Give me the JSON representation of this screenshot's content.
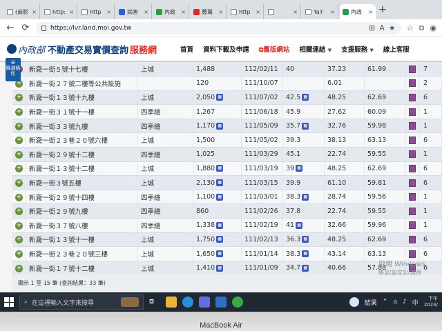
{
  "browser": {
    "tabs": [
      {
        "label": "(商影",
        "icon": "doc"
      },
      {
        "label": "http:",
        "icon": "doc"
      },
      {
        "label": "http",
        "icon": "doc"
      },
      {
        "label": "病害",
        "icon": "blue"
      },
      {
        "label": "內政",
        "icon": "green"
      },
      {
        "label": "豐萬",
        "icon": "red"
      },
      {
        "label": "http",
        "icon": "doc"
      },
      {
        "label": "",
        "icon": "doc"
      },
      {
        "label": "YaY",
        "icon": "doc"
      },
      {
        "label": "內政",
        "icon": "green"
      }
    ],
    "url": "https://lvr.land.moi.gov.tw"
  },
  "site": {
    "ministry": "內政部",
    "title": "不動產交易實價查詢",
    "title_suffix": "服務網",
    "nav": {
      "home": "首頁",
      "download": "資料下載及申請",
      "old_site": "舊版網站",
      "links": "相關連結",
      "support": "支援服務",
      "online": "線上客服"
    },
    "float_button": "篩選條件"
  },
  "table": {
    "rows": [
      {
        "address": "新瀧一街５號十七樓",
        "community": "上城",
        "price": "1,488",
        "pin_price": false,
        "date": "112/02/11",
        "area": "40",
        "pin_area": false,
        "price_a": "37.23",
        "price_b": "61.99",
        "floor": "7"
      },
      {
        "address": "新瀧一街２７號二樓等公共設施",
        "community": "",
        "price": "120",
        "pin_price": false,
        "date": "111/10/07",
        "area": "",
        "pin_area": false,
        "price_a": "6.01",
        "price_b": "",
        "floor": "2"
      },
      {
        "address": "新瀧一街１３號十九樓",
        "community": "上城",
        "price": "2,050",
        "pin_price": true,
        "date": "111/07/02",
        "area": "42.5",
        "pin_area": true,
        "price_a": "48.25",
        "price_b": "62.69",
        "floor": "6"
      },
      {
        "address": "新瀧一街３１號十一樓",
        "community": "四季繪",
        "price": "1,267",
        "pin_price": false,
        "date": "111/06/18",
        "area": "45.9",
        "pin_area": false,
        "price_a": "27.62",
        "price_b": "60.09",
        "floor": "1"
      },
      {
        "address": "新瀧一街３３號九樓",
        "community": "四季繪",
        "price": "1,170",
        "pin_price": true,
        "date": "111/05/09",
        "area": "35.7",
        "pin_area": true,
        "price_a": "32.76",
        "price_b": "59.98",
        "floor": "1"
      },
      {
        "address": "新瀧一街２３巷２０號六樓",
        "community": "上城",
        "price": "1,500",
        "pin_price": false,
        "date": "111/05/02",
        "area": "39.3",
        "pin_area": false,
        "price_a": "38.13",
        "price_b": "63.13",
        "floor": "6"
      },
      {
        "address": "新瀧一街２９號十二樓",
        "community": "四季繪",
        "price": "1,025",
        "pin_price": false,
        "date": "111/03/29",
        "area": "45.1",
        "pin_area": false,
        "price_a": "22.74",
        "price_b": "59.55",
        "floor": "1"
      },
      {
        "address": "新瀧一街１３號十二樓",
        "community": "上城",
        "price": "1,880",
        "pin_price": true,
        "date": "111/03/19",
        "area": "39",
        "pin_area": true,
        "price_a": "48.25",
        "price_b": "62.69",
        "floor": "6"
      },
      {
        "address": "新瀧一街３號五樓",
        "community": "上城",
        "price": "2,130",
        "pin_price": true,
        "date": "111/03/15",
        "area": "39.9",
        "pin_area": false,
        "price_a": "61.10",
        "price_b": "59.81",
        "floor": "6"
      },
      {
        "address": "新瀧一街２９號十四樓",
        "community": "四季繪",
        "price": "1,100",
        "pin_price": true,
        "date": "111/03/01",
        "area": "38.3",
        "pin_area": true,
        "price_a": "28.74",
        "price_b": "59.56",
        "floor": "1"
      },
      {
        "address": "新瀧一街２９號九樓",
        "community": "四季繪",
        "price": "860",
        "pin_price": false,
        "date": "111/02/26",
        "area": "37.8",
        "pin_area": false,
        "price_a": "22.74",
        "price_b": "59.55",
        "floor": "1"
      },
      {
        "address": "新瀧一街３７號八樓",
        "community": "四季繪",
        "price": "1,338",
        "pin_price": true,
        "date": "111/02/19",
        "area": "41",
        "pin_area": true,
        "price_a": "32.66",
        "price_b": "59.96",
        "floor": "1"
      },
      {
        "address": "新瀧一街１３號十一樓",
        "community": "上城",
        "price": "1,750",
        "pin_price": true,
        "date": "111/02/13",
        "area": "36.3",
        "pin_area": true,
        "price_a": "48.25",
        "price_b": "62.69",
        "floor": "6"
      },
      {
        "address": "新瀧一街２３巷２０號三樓",
        "community": "上城",
        "price": "1,650",
        "pin_price": true,
        "date": "111/01/14",
        "area": "38.3",
        "pin_area": true,
        "price_a": "43.14",
        "price_b": "63.13",
        "floor": "6"
      },
      {
        "address": "新瀧一街１７號十二樓",
        "community": "上城",
        "price": "1,410",
        "pin_price": true,
        "date": "111/01/09",
        "area": "34.7",
        "pin_area": true,
        "price_a": "40.66",
        "price_b": "57.88",
        "floor": "6"
      }
    ],
    "footer": "顯示 1 至 15 筆 (查詢結果：33 筆)"
  },
  "watermark": {
    "line1": "啟用 Windows",
    "line2": "移至[設定]以啟用"
  },
  "taskbar": {
    "search_placeholder": "在這裡輸入文字來搜尋",
    "stock_label": "結果",
    "lang": "中",
    "time": "下午",
    "date": "2023/"
  },
  "laptop_brand": "MacBook Air"
}
